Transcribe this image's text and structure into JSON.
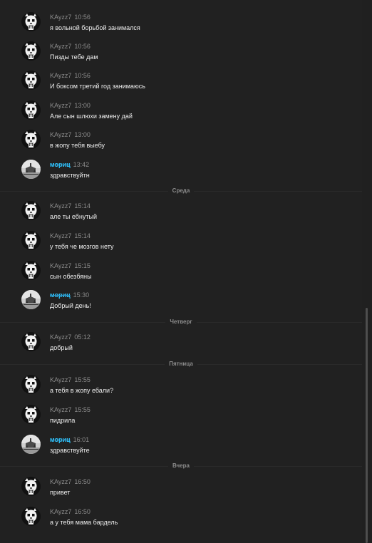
{
  "colors": {
    "background": "#212121",
    "author_default": "#8b8b8b",
    "author_accent": "#2fc6ff",
    "message_text": "#ececec",
    "separator_text": "#8c8c8c"
  },
  "messages": [
    {
      "author": "KAyzz7",
      "time": "10:56",
      "text": "я вольной борьбой занимался",
      "avatar_icon": "skull-avatar-icon"
    },
    {
      "author": "KAyzz7",
      "time": "10:56",
      "text": "Пизды тебе дам",
      "avatar_icon": "skull-avatar-icon"
    },
    {
      "author": "KAyzz7",
      "time": "10:56",
      "text": "И боксом третий год занимаюсь",
      "avatar_icon": "skull-avatar-icon"
    },
    {
      "author": "KAyzz7",
      "time": "13:00",
      "text": "Але сын шлюхи замену дай",
      "avatar_icon": "skull-avatar-icon"
    },
    {
      "author": "KAyzz7",
      "time": "13:00",
      "text": "в жопу тебя выебу",
      "avatar_icon": "skull-avatar-icon"
    },
    {
      "author": "мориц",
      "time": "13:42",
      "text": "здравствуйтн",
      "avatar_icon": "landscape-avatar-icon"
    },
    {
      "author": "KAyzz7",
      "time": "15:14",
      "text": "але ты ебнутый",
      "avatar_icon": "skull-avatar-icon"
    },
    {
      "author": "KAyzz7",
      "time": "15:14",
      "text": "у тебя че мозгов нету",
      "avatar_icon": "skull-avatar-icon"
    },
    {
      "author": "KAyzz7",
      "time": "15:15",
      "text": "сын обезбяны",
      "avatar_icon": "skull-avatar-icon"
    },
    {
      "author": "мориц",
      "time": "15:30",
      "text": "Добрый день!",
      "avatar_icon": "landscape-avatar-icon"
    },
    {
      "author": "KAyzz7",
      "time": "05:12",
      "text": "добрый",
      "avatar_icon": "skull-avatar-icon"
    },
    {
      "author": "KAyzz7",
      "time": "15:55",
      "text": "а тебя в жопу ебали?",
      "avatar_icon": "skull-avatar-icon"
    },
    {
      "author": "KAyzz7",
      "time": "15:55",
      "text": "пидрила",
      "avatar_icon": "skull-avatar-icon"
    },
    {
      "author": "мориц",
      "time": "16:01",
      "text": "здравствуйте",
      "avatar_icon": "landscape-avatar-icon"
    },
    {
      "author": "KAyzz7",
      "time": "16:50",
      "text": "привет",
      "avatar_icon": "skull-avatar-icon"
    },
    {
      "author": "KAyzz7",
      "time": "16:50",
      "text": "а у тебя мама бардель",
      "avatar_icon": "skull-avatar-icon"
    }
  ],
  "separators": [
    {
      "label": "Среда"
    },
    {
      "label": "Четверг"
    },
    {
      "label": "Пятница"
    },
    {
      "label": "Вчера"
    }
  ]
}
